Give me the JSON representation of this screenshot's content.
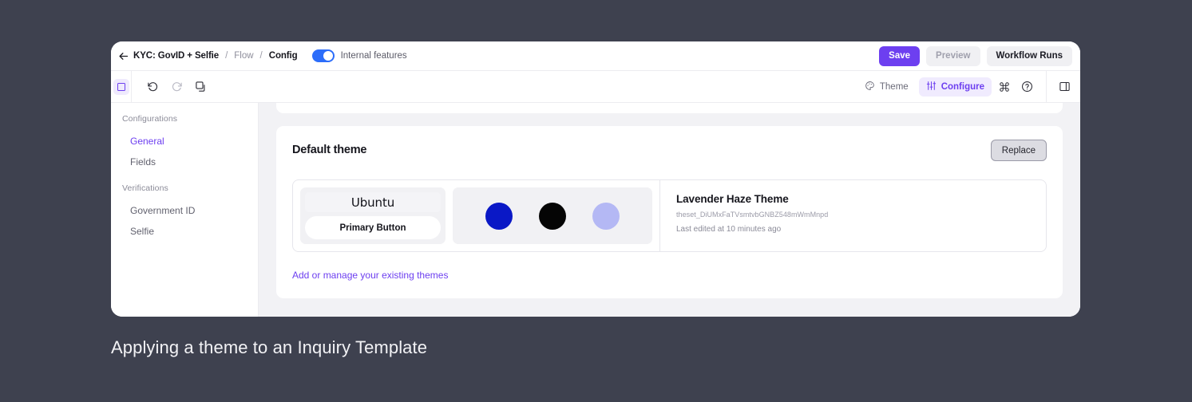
{
  "window": {
    "topbar": {
      "back_icon": "arrow-left-icon",
      "breadcrumb": {
        "template_name": "KYC: GovID + Selfie",
        "sep1": "/",
        "flow": "Flow",
        "sep2": "/",
        "config": "Config"
      },
      "internal_features": {
        "label": "Internal features",
        "enabled": true,
        "toggle_color": "#2c6dfa"
      },
      "actions": {
        "save": "Save",
        "preview": "Preview",
        "workflow_runs": "Workflow Runs",
        "save_color": "#6d3ff0"
      }
    },
    "toolbar": {
      "panel_toggle_icon": "left-panel-toggle-icon",
      "undo_icon": "undo-icon",
      "redo_icon": "redo-icon",
      "duplicate_icon": "duplicate-icon",
      "theme_label": "Theme",
      "theme_icon": "palette-icon",
      "configure_label": "Configure",
      "configure_icon": "sliders-icon",
      "command_icon": "command-icon",
      "help_icon": "help-circle-icon",
      "right_panel_icon": "right-panel-toggle-icon",
      "active_color": "#6d3ff0"
    },
    "sidebar": {
      "groups": [
        {
          "header": "Configurations",
          "items": [
            {
              "label": "General",
              "active": true
            },
            {
              "label": "Fields",
              "active": false
            }
          ]
        },
        {
          "header": "Verifications",
          "items": [
            {
              "label": "Government ID",
              "active": false
            },
            {
              "label": "Selfie",
              "active": false
            }
          ]
        }
      ]
    },
    "main": {
      "card_title": "Default theme",
      "replace_button": "Replace",
      "theme": {
        "font_sample": "Ubuntu",
        "primary_button_label": "Primary Button",
        "swatches": [
          {
            "name": "primary-color-swatch",
            "hex": "#0a18c6"
          },
          {
            "name": "secondary-color-swatch",
            "hex": "#050505"
          },
          {
            "name": "accent-color-swatch",
            "hex": "#b4b8f4"
          }
        ],
        "name": "Lavender Haze Theme",
        "id": "theset_DiUMxFaTVsmtvbGNBZ548mWmMnpd",
        "last_edited": "Last edited at 10 minutes ago"
      },
      "manage_link": "Add or manage your existing themes"
    }
  },
  "caption": "Applying a theme to an Inquiry Template"
}
